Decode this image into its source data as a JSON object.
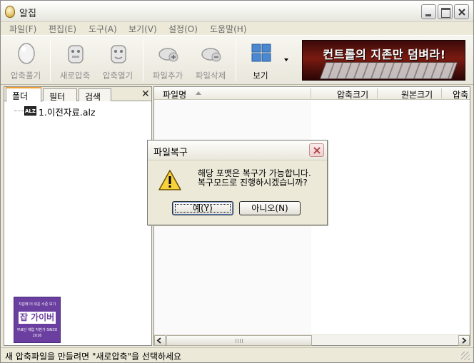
{
  "window": {
    "title": "알집"
  },
  "menu": [
    "파일(F)",
    "편집(E)",
    "도구(A)",
    "보기(V)",
    "설정(O)",
    "도움말(H)"
  ],
  "toolbar": {
    "tools": [
      {
        "label": "압축풀기",
        "icon": "extract-egg-icon",
        "enabled": false
      },
      {
        "label": "새로압축",
        "icon": "new-archive-icon",
        "enabled": false
      },
      {
        "label": "압축열기",
        "icon": "open-archive-icon",
        "enabled": false
      },
      {
        "label": "파일추가",
        "icon": "add-file-icon",
        "enabled": false
      },
      {
        "label": "파일삭제",
        "icon": "delete-file-icon",
        "enabled": false
      },
      {
        "label": "보기",
        "icon": "view-grid-icon",
        "enabled": true
      }
    ],
    "banner_text": "컨트롤의 지존만 덤벼라!"
  },
  "left_panel": {
    "tabs": [
      "폴더",
      "필터",
      "검색"
    ],
    "close_symbol": "✕",
    "tree": [
      {
        "icon_text": "ALZ",
        "label": "1.이전자료.alz"
      }
    ],
    "ad": {
      "top_text": "지갑에 더 쉬운 수준 보기 ",
      "logo": "잡 가이버",
      "bottom_text": "무료단 채업 자반가 SINCE 2016"
    }
  },
  "file_list": {
    "columns": [
      "파일명",
      "압축크기",
      "원본크기",
      "압축"
    ]
  },
  "status": {
    "text": "새 압축파일을 만들려면 \"새로압축\"을 선택하세요"
  },
  "dialog": {
    "title": "파일복구",
    "message_line1": "해당 포맷은 복구가 가능합니다.",
    "message_line2": "복구모드로 진행하시겠습니까?",
    "yes_label": "예(Y)",
    "no_label": "아니오(N)"
  },
  "colors": {
    "window_bg": "#ece9d8",
    "tab_accent": "#f0a030",
    "banner_bg": "#7a1a10",
    "ad_bg": "#6b3fa0"
  }
}
